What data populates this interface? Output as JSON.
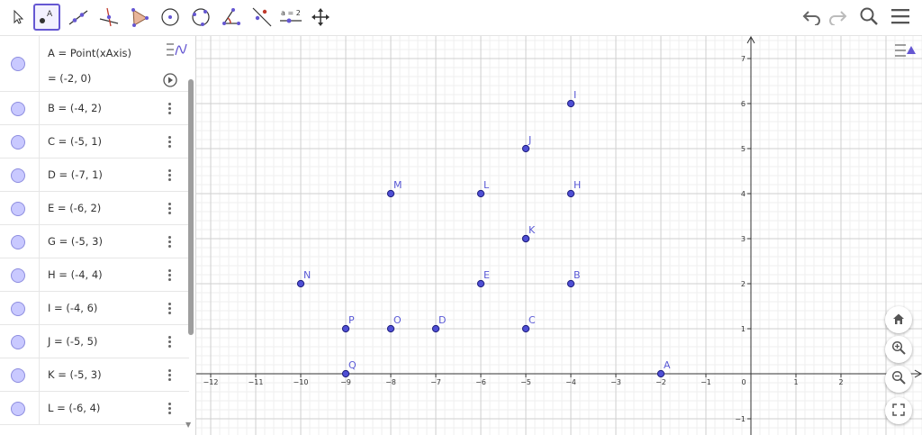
{
  "toolbar": {
    "tools": [
      {
        "icon": "move-arrow-icon"
      },
      {
        "icon": "point-icon",
        "label": "A",
        "selected": true
      },
      {
        "icon": "line-icon"
      },
      {
        "icon": "perpendicular-line-icon"
      },
      {
        "icon": "polygon-icon"
      },
      {
        "icon": "circle-center-point-icon"
      },
      {
        "icon": "circle-three-points-icon"
      },
      {
        "icon": "angle-icon"
      },
      {
        "icon": "reflect-icon"
      },
      {
        "icon": "slider-icon",
        "label": "a = 2"
      },
      {
        "icon": "move-graphics-view-icon"
      }
    ],
    "right": [
      "undo-icon",
      "redo-icon",
      "search-icon",
      "menu-icon"
    ]
  },
  "algebra": {
    "first": {
      "definition": "A = Point(xAxis)",
      "value": "= (-2, 0)"
    },
    "items": [
      "B = (-4, 2)",
      "C = (-5, 1)",
      "D = (-7, 1)",
      "E = (-6, 2)",
      "G = (-5, 3)",
      "H = (-4, 4)",
      "I = (-4, 6)",
      "J = (-5, 5)",
      "K = (-5, 3)",
      "L = (-6, 4)"
    ]
  },
  "graphics": {
    "x_ticks": [
      "−12",
      "−11",
      "−10",
      "−9",
      "−8",
      "−7",
      "−6",
      "−5",
      "−4",
      "−3",
      "−2",
      "−1",
      "0",
      "1",
      "2"
    ],
    "x_values": [
      -12,
      -11,
      -10,
      -9,
      -8,
      -7,
      -6,
      -5,
      -4,
      -3,
      -2,
      -1,
      0,
      1,
      2
    ],
    "y_ticks": [
      "7",
      "6",
      "5",
      "4",
      "3",
      "2",
      "1",
      "−1"
    ],
    "y_values": [
      7,
      6,
      5,
      4,
      3,
      2,
      1,
      -1
    ],
    "points": [
      {
        "name": "A",
        "x": -2,
        "y": 0
      },
      {
        "name": "B",
        "x": -4,
        "y": 2
      },
      {
        "name": "C",
        "x": -5,
        "y": 1
      },
      {
        "name": "D",
        "x": -7,
        "y": 1
      },
      {
        "name": "E",
        "x": -6,
        "y": 2
      },
      {
        "name": "G",
        "x": -5,
        "y": 3
      },
      {
        "name": "K",
        "x": -5,
        "y": 3
      },
      {
        "name": "H",
        "x": -4,
        "y": 4
      },
      {
        "name": "I",
        "x": -4,
        "y": 6
      },
      {
        "name": "J",
        "x": -5,
        "y": 5
      },
      {
        "name": "L",
        "x": -6,
        "y": 4
      },
      {
        "name": "M",
        "x": -8,
        "y": 4
      },
      {
        "name": "N",
        "x": -10,
        "y": 2
      },
      {
        "name": "O",
        "x": -8,
        "y": 1
      },
      {
        "name": "P",
        "x": -9,
        "y": 1
      },
      {
        "name": "Q",
        "x": -9,
        "y": 0
      }
    ],
    "visible_labels": [
      "A",
      "B",
      "C",
      "D",
      "E",
      "K",
      "H",
      "I",
      "J",
      "L",
      "M",
      "N",
      "O",
      "P",
      "Q"
    ],
    "buttons": [
      "home-icon",
      "zoom-in-icon",
      "zoom-out-icon",
      "fullscreen-icon"
    ]
  }
}
